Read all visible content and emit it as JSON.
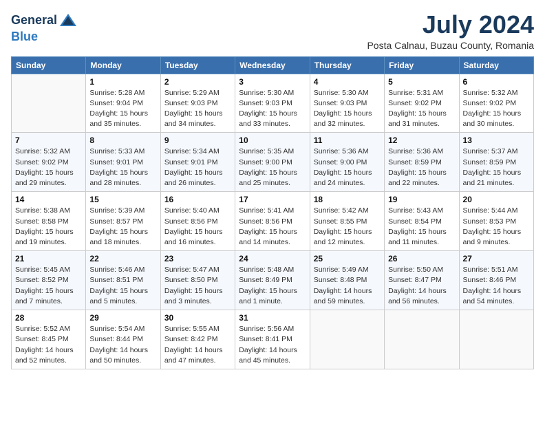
{
  "header": {
    "logo_general": "General",
    "logo_blue": "Blue",
    "month_title": "July 2024",
    "location": "Posta Calnau, Buzau County, Romania"
  },
  "calendar": {
    "days_of_week": [
      "Sunday",
      "Monday",
      "Tuesday",
      "Wednesday",
      "Thursday",
      "Friday",
      "Saturday"
    ],
    "weeks": [
      [
        {
          "day": "",
          "detail": ""
        },
        {
          "day": "1",
          "detail": "Sunrise: 5:28 AM\nSunset: 9:04 PM\nDaylight: 15 hours\nand 35 minutes."
        },
        {
          "day": "2",
          "detail": "Sunrise: 5:29 AM\nSunset: 9:03 PM\nDaylight: 15 hours\nand 34 minutes."
        },
        {
          "day": "3",
          "detail": "Sunrise: 5:30 AM\nSunset: 9:03 PM\nDaylight: 15 hours\nand 33 minutes."
        },
        {
          "day": "4",
          "detail": "Sunrise: 5:30 AM\nSunset: 9:03 PM\nDaylight: 15 hours\nand 32 minutes."
        },
        {
          "day": "5",
          "detail": "Sunrise: 5:31 AM\nSunset: 9:02 PM\nDaylight: 15 hours\nand 31 minutes."
        },
        {
          "day": "6",
          "detail": "Sunrise: 5:32 AM\nSunset: 9:02 PM\nDaylight: 15 hours\nand 30 minutes."
        }
      ],
      [
        {
          "day": "7",
          "detail": "Sunrise: 5:32 AM\nSunset: 9:02 PM\nDaylight: 15 hours\nand 29 minutes."
        },
        {
          "day": "8",
          "detail": "Sunrise: 5:33 AM\nSunset: 9:01 PM\nDaylight: 15 hours\nand 28 minutes."
        },
        {
          "day": "9",
          "detail": "Sunrise: 5:34 AM\nSunset: 9:01 PM\nDaylight: 15 hours\nand 26 minutes."
        },
        {
          "day": "10",
          "detail": "Sunrise: 5:35 AM\nSunset: 9:00 PM\nDaylight: 15 hours\nand 25 minutes."
        },
        {
          "day": "11",
          "detail": "Sunrise: 5:36 AM\nSunset: 9:00 PM\nDaylight: 15 hours\nand 24 minutes."
        },
        {
          "day": "12",
          "detail": "Sunrise: 5:36 AM\nSunset: 8:59 PM\nDaylight: 15 hours\nand 22 minutes."
        },
        {
          "day": "13",
          "detail": "Sunrise: 5:37 AM\nSunset: 8:59 PM\nDaylight: 15 hours\nand 21 minutes."
        }
      ],
      [
        {
          "day": "14",
          "detail": "Sunrise: 5:38 AM\nSunset: 8:58 PM\nDaylight: 15 hours\nand 19 minutes."
        },
        {
          "day": "15",
          "detail": "Sunrise: 5:39 AM\nSunset: 8:57 PM\nDaylight: 15 hours\nand 18 minutes."
        },
        {
          "day": "16",
          "detail": "Sunrise: 5:40 AM\nSunset: 8:56 PM\nDaylight: 15 hours\nand 16 minutes."
        },
        {
          "day": "17",
          "detail": "Sunrise: 5:41 AM\nSunset: 8:56 PM\nDaylight: 15 hours\nand 14 minutes."
        },
        {
          "day": "18",
          "detail": "Sunrise: 5:42 AM\nSunset: 8:55 PM\nDaylight: 15 hours\nand 12 minutes."
        },
        {
          "day": "19",
          "detail": "Sunrise: 5:43 AM\nSunset: 8:54 PM\nDaylight: 15 hours\nand 11 minutes."
        },
        {
          "day": "20",
          "detail": "Sunrise: 5:44 AM\nSunset: 8:53 PM\nDaylight: 15 hours\nand 9 minutes."
        }
      ],
      [
        {
          "day": "21",
          "detail": "Sunrise: 5:45 AM\nSunset: 8:52 PM\nDaylight: 15 hours\nand 7 minutes."
        },
        {
          "day": "22",
          "detail": "Sunrise: 5:46 AM\nSunset: 8:51 PM\nDaylight: 15 hours\nand 5 minutes."
        },
        {
          "day": "23",
          "detail": "Sunrise: 5:47 AM\nSunset: 8:50 PM\nDaylight: 15 hours\nand 3 minutes."
        },
        {
          "day": "24",
          "detail": "Sunrise: 5:48 AM\nSunset: 8:49 PM\nDaylight: 15 hours\nand 1 minute."
        },
        {
          "day": "25",
          "detail": "Sunrise: 5:49 AM\nSunset: 8:48 PM\nDaylight: 14 hours\nand 59 minutes."
        },
        {
          "day": "26",
          "detail": "Sunrise: 5:50 AM\nSunset: 8:47 PM\nDaylight: 14 hours\nand 56 minutes."
        },
        {
          "day": "27",
          "detail": "Sunrise: 5:51 AM\nSunset: 8:46 PM\nDaylight: 14 hours\nand 54 minutes."
        }
      ],
      [
        {
          "day": "28",
          "detail": "Sunrise: 5:52 AM\nSunset: 8:45 PM\nDaylight: 14 hours\nand 52 minutes."
        },
        {
          "day": "29",
          "detail": "Sunrise: 5:54 AM\nSunset: 8:44 PM\nDaylight: 14 hours\nand 50 minutes."
        },
        {
          "day": "30",
          "detail": "Sunrise: 5:55 AM\nSunset: 8:42 PM\nDaylight: 14 hours\nand 47 minutes."
        },
        {
          "day": "31",
          "detail": "Sunrise: 5:56 AM\nSunset: 8:41 PM\nDaylight: 14 hours\nand 45 minutes."
        },
        {
          "day": "",
          "detail": ""
        },
        {
          "day": "",
          "detail": ""
        },
        {
          "day": "",
          "detail": ""
        }
      ]
    ]
  }
}
